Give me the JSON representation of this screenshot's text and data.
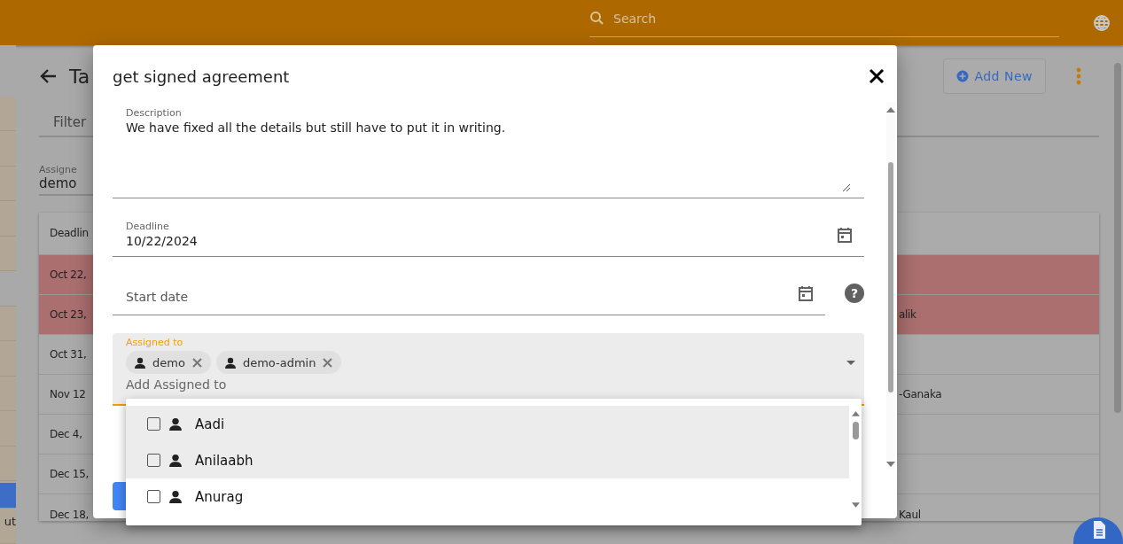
{
  "header": {
    "search": {
      "placeholder": "Search"
    }
  },
  "sidebar": {
    "items": [
      {
        "selected": false
      },
      {
        "selected": false
      },
      {
        "selected": false
      },
      {
        "selected": false
      },
      {
        "selected": false
      },
      {
        "kind": "gap",
        "selected": false
      },
      {
        "selected": false
      },
      {
        "selected": false
      },
      {
        "selected": false
      },
      {
        "selected": false
      },
      {
        "selected": false
      },
      {
        "selected": true
      },
      {
        "label": "ut",
        "selected": false
      }
    ]
  },
  "page": {
    "title": "Ta",
    "filter_label": "Filter",
    "assigned_filter": {
      "label": "Assigne",
      "value": "demo"
    },
    "add_new": "Add New",
    "table": {
      "header": "Deadlin",
      "rows": [
        {
          "date": "Oct 22,",
          "overdue": true
        },
        {
          "date": "Oct 23,",
          "assignee": "alik",
          "overdue": true
        },
        {
          "date": "Oct 31,",
          "overdue": false
        },
        {
          "date": "Nov 12",
          "assignee": "-Ganaka",
          "overdue": false
        },
        {
          "date": "Dec 4,",
          "overdue": false
        },
        {
          "date": "Dec 15,",
          "overdue": false
        },
        {
          "date": "Dec 18,",
          "assignee": "Kaul",
          "overdue": false
        }
      ]
    }
  },
  "dialog": {
    "title": "get signed agreement",
    "fields": [
      {
        "kind": "textarea",
        "label": "Description",
        "value": "We have fixed all the details but still have to put it in writing."
      },
      {
        "kind": "date",
        "label": "Deadline",
        "value": "10/22/2024"
      },
      {
        "kind": "date",
        "placeholder": "Start date",
        "help_icon": "?"
      }
    ],
    "assigned": {
      "label": "Assigned to",
      "chips": [
        "demo",
        "demo-admin"
      ],
      "placeholder": "Add Assigned to",
      "options": [
        {
          "label": "Aadi",
          "checked": false,
          "highlighted": true
        },
        {
          "label": "Anilaabh",
          "checked": false,
          "highlighted": true
        },
        {
          "label": "Anurag",
          "checked": false,
          "highlighted": false
        }
      ]
    }
  }
}
